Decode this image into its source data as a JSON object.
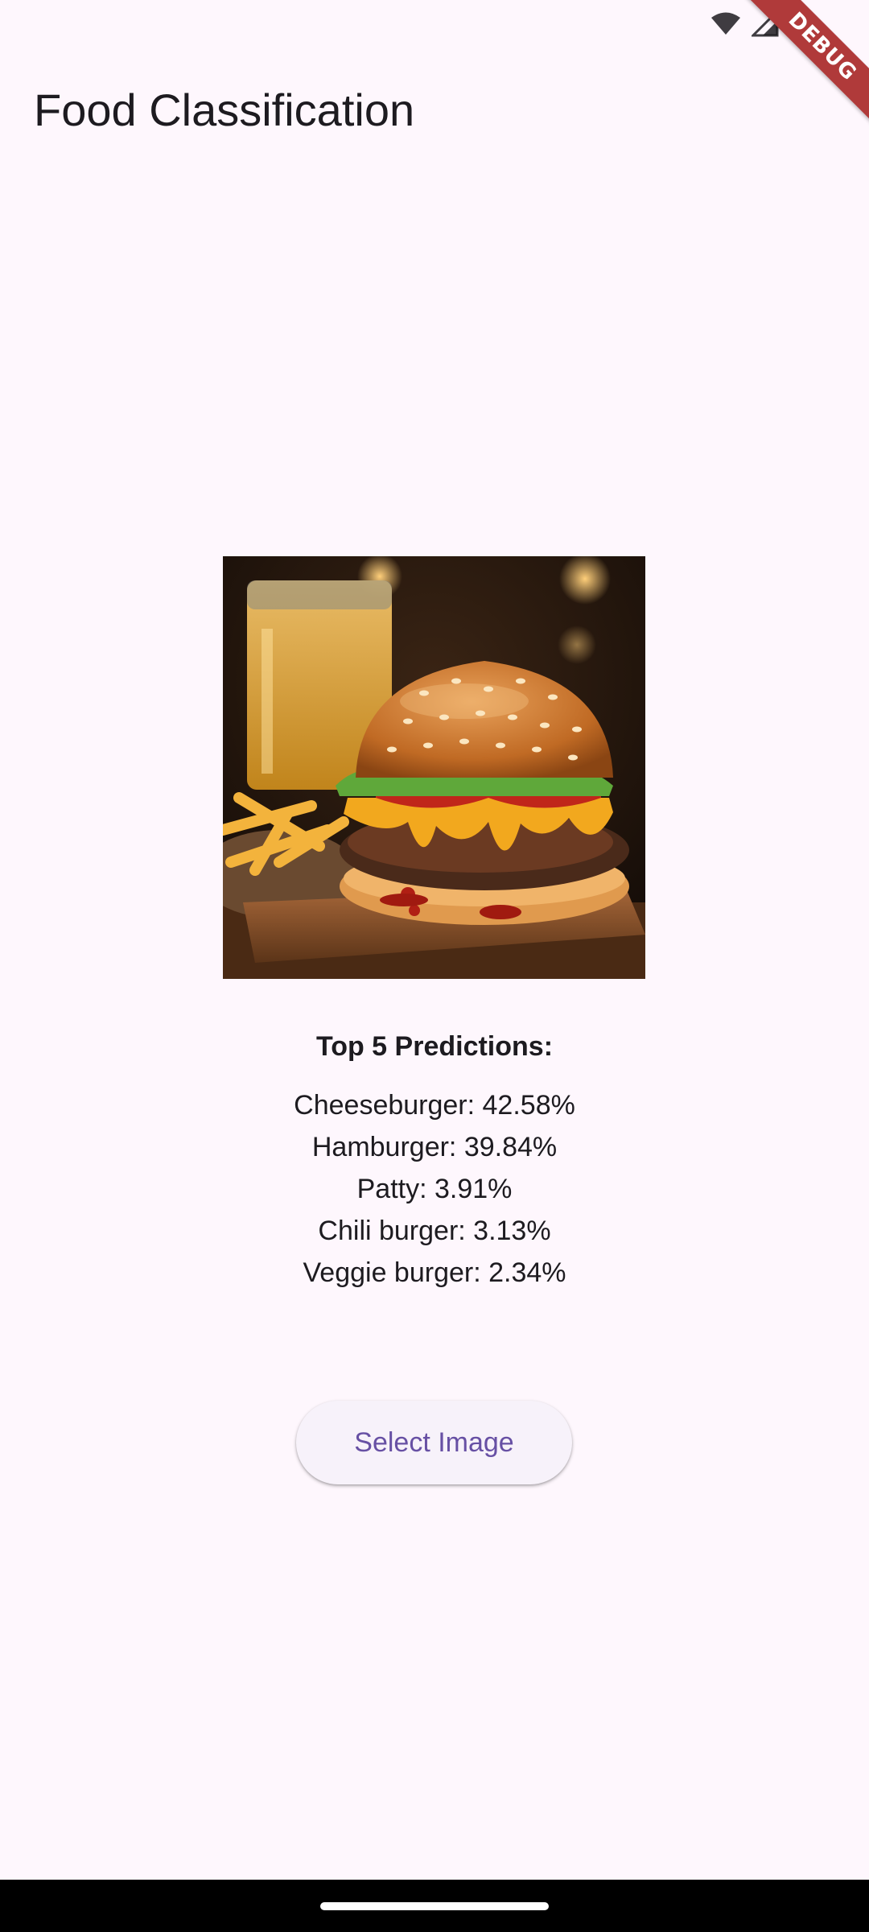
{
  "status_bar": {
    "icons": [
      "wifi-icon",
      "cellular-signal-icon",
      "battery-icon"
    ]
  },
  "debug_banner": {
    "label": "DEBUG",
    "color": "#b03a3a"
  },
  "app_bar": {
    "title": "Food Classification"
  },
  "image": {
    "subject": "cheeseburger with fries and a drink"
  },
  "predictions": {
    "heading": "Top 5 Predictions:",
    "items": [
      {
        "label": "Cheeseburger: 42.58%"
      },
      {
        "label": "Hamburger: 39.84%"
      },
      {
        "label": "Patty: 3.91%"
      },
      {
        "label": "Chili burger: 3.13%"
      },
      {
        "label": "Veggie burger: 2.34%"
      }
    ]
  },
  "actions": {
    "select_image_label": "Select Image"
  },
  "colors": {
    "background": "#fef7fd",
    "accent": "#6750a4",
    "button_bg": "#f7f2fa",
    "text": "#1d1b20"
  }
}
